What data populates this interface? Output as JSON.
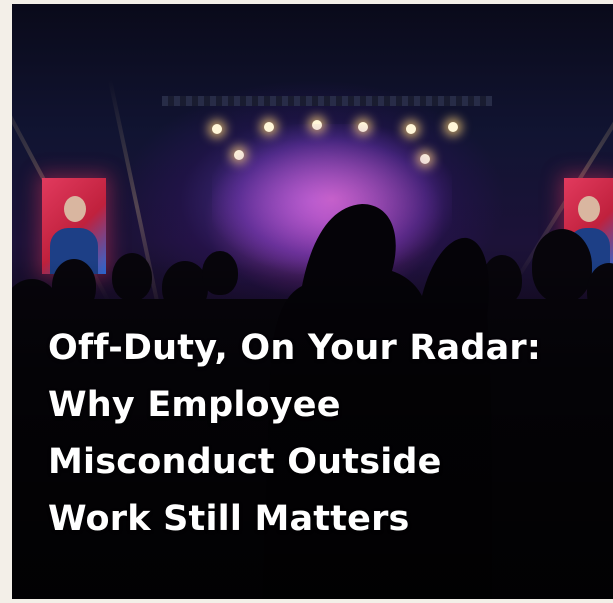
{
  "image": {
    "alt": "Concert crowd silhouette of a couple kissing in front of a lit stage",
    "colors": {
      "page_background": "#f3efe8",
      "headline_text": "#ffffff",
      "stage_magenta": "#e23a5e",
      "stage_purple": "#8c5aff"
    }
  },
  "headline": {
    "line1": "Off-Duty, On Your Radar:",
    "line2": "Why Employee",
    "line3": "Misconduct Outside",
    "line4": "Work Still Matters"
  }
}
